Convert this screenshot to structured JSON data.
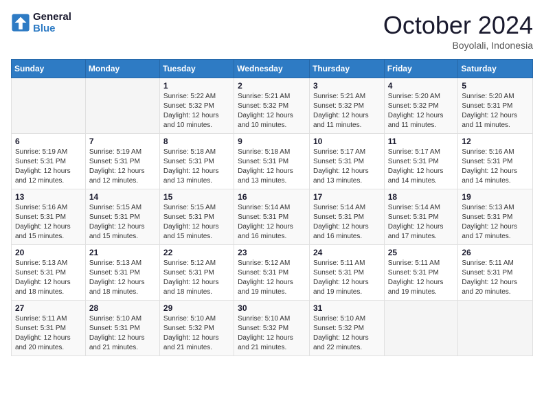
{
  "header": {
    "logo_line1": "General",
    "logo_line2": "Blue",
    "month": "October 2024",
    "location": "Boyolali, Indonesia"
  },
  "weekdays": [
    "Sunday",
    "Monday",
    "Tuesday",
    "Wednesday",
    "Thursday",
    "Friday",
    "Saturday"
  ],
  "weeks": [
    [
      {
        "day": "",
        "info": ""
      },
      {
        "day": "",
        "info": ""
      },
      {
        "day": "1",
        "info": "Sunrise: 5:22 AM\nSunset: 5:32 PM\nDaylight: 12 hours\nand 10 minutes."
      },
      {
        "day": "2",
        "info": "Sunrise: 5:21 AM\nSunset: 5:32 PM\nDaylight: 12 hours\nand 10 minutes."
      },
      {
        "day": "3",
        "info": "Sunrise: 5:21 AM\nSunset: 5:32 PM\nDaylight: 12 hours\nand 11 minutes."
      },
      {
        "day": "4",
        "info": "Sunrise: 5:20 AM\nSunset: 5:32 PM\nDaylight: 12 hours\nand 11 minutes."
      },
      {
        "day": "5",
        "info": "Sunrise: 5:20 AM\nSunset: 5:31 PM\nDaylight: 12 hours\nand 11 minutes."
      }
    ],
    [
      {
        "day": "6",
        "info": "Sunrise: 5:19 AM\nSunset: 5:31 PM\nDaylight: 12 hours\nand 12 minutes."
      },
      {
        "day": "7",
        "info": "Sunrise: 5:19 AM\nSunset: 5:31 PM\nDaylight: 12 hours\nand 12 minutes."
      },
      {
        "day": "8",
        "info": "Sunrise: 5:18 AM\nSunset: 5:31 PM\nDaylight: 12 hours\nand 13 minutes."
      },
      {
        "day": "9",
        "info": "Sunrise: 5:18 AM\nSunset: 5:31 PM\nDaylight: 12 hours\nand 13 minutes."
      },
      {
        "day": "10",
        "info": "Sunrise: 5:17 AM\nSunset: 5:31 PM\nDaylight: 12 hours\nand 13 minutes."
      },
      {
        "day": "11",
        "info": "Sunrise: 5:17 AM\nSunset: 5:31 PM\nDaylight: 12 hours\nand 14 minutes."
      },
      {
        "day": "12",
        "info": "Sunrise: 5:16 AM\nSunset: 5:31 PM\nDaylight: 12 hours\nand 14 minutes."
      }
    ],
    [
      {
        "day": "13",
        "info": "Sunrise: 5:16 AM\nSunset: 5:31 PM\nDaylight: 12 hours\nand 15 minutes."
      },
      {
        "day": "14",
        "info": "Sunrise: 5:15 AM\nSunset: 5:31 PM\nDaylight: 12 hours\nand 15 minutes."
      },
      {
        "day": "15",
        "info": "Sunrise: 5:15 AM\nSunset: 5:31 PM\nDaylight: 12 hours\nand 15 minutes."
      },
      {
        "day": "16",
        "info": "Sunrise: 5:14 AM\nSunset: 5:31 PM\nDaylight: 12 hours\nand 16 minutes."
      },
      {
        "day": "17",
        "info": "Sunrise: 5:14 AM\nSunset: 5:31 PM\nDaylight: 12 hours\nand 16 minutes."
      },
      {
        "day": "18",
        "info": "Sunrise: 5:14 AM\nSunset: 5:31 PM\nDaylight: 12 hours\nand 17 minutes."
      },
      {
        "day": "19",
        "info": "Sunrise: 5:13 AM\nSunset: 5:31 PM\nDaylight: 12 hours\nand 17 minutes."
      }
    ],
    [
      {
        "day": "20",
        "info": "Sunrise: 5:13 AM\nSunset: 5:31 PM\nDaylight: 12 hours\nand 18 minutes."
      },
      {
        "day": "21",
        "info": "Sunrise: 5:13 AM\nSunset: 5:31 PM\nDaylight: 12 hours\nand 18 minutes."
      },
      {
        "day": "22",
        "info": "Sunrise: 5:12 AM\nSunset: 5:31 PM\nDaylight: 12 hours\nand 18 minutes."
      },
      {
        "day": "23",
        "info": "Sunrise: 5:12 AM\nSunset: 5:31 PM\nDaylight: 12 hours\nand 19 minutes."
      },
      {
        "day": "24",
        "info": "Sunrise: 5:11 AM\nSunset: 5:31 PM\nDaylight: 12 hours\nand 19 minutes."
      },
      {
        "day": "25",
        "info": "Sunrise: 5:11 AM\nSunset: 5:31 PM\nDaylight: 12 hours\nand 19 minutes."
      },
      {
        "day": "26",
        "info": "Sunrise: 5:11 AM\nSunset: 5:31 PM\nDaylight: 12 hours\nand 20 minutes."
      }
    ],
    [
      {
        "day": "27",
        "info": "Sunrise: 5:11 AM\nSunset: 5:31 PM\nDaylight: 12 hours\nand 20 minutes."
      },
      {
        "day": "28",
        "info": "Sunrise: 5:10 AM\nSunset: 5:31 PM\nDaylight: 12 hours\nand 21 minutes."
      },
      {
        "day": "29",
        "info": "Sunrise: 5:10 AM\nSunset: 5:32 PM\nDaylight: 12 hours\nand 21 minutes."
      },
      {
        "day": "30",
        "info": "Sunrise: 5:10 AM\nSunset: 5:32 PM\nDaylight: 12 hours\nand 21 minutes."
      },
      {
        "day": "31",
        "info": "Sunrise: 5:10 AM\nSunset: 5:32 PM\nDaylight: 12 hours\nand 22 minutes."
      },
      {
        "day": "",
        "info": ""
      },
      {
        "day": "",
        "info": ""
      }
    ]
  ]
}
